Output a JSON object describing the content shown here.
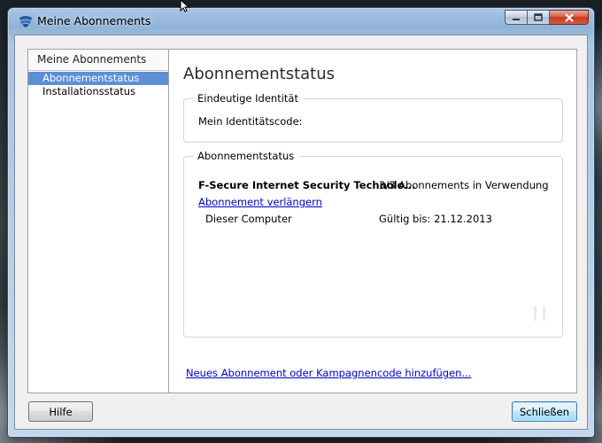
{
  "window": {
    "title": "Meine Abonnements"
  },
  "sidebar": {
    "header": "Meine Abonnements",
    "items": [
      {
        "label": "Abonnementstatus",
        "selected": true
      },
      {
        "label": "Installationsstatus",
        "selected": false
      }
    ]
  },
  "main": {
    "title": "Abonnementstatus",
    "identity": {
      "legend": "Eindeutige Identität",
      "code_label": "Mein Identitätscode:"
    },
    "status": {
      "legend": "Abonnementstatus",
      "product_name": "F-Secure Internet Security Technolo...",
      "usage": "3/3 Abonnements in Verwendung",
      "renew_link": "Abonnement verlängern",
      "computer_label": "Dieser Computer",
      "valid_until": "Gültig bis: 21.12.2013"
    },
    "add_link": "Neues Abonnement oder Kampagnencode hinzufügen..."
  },
  "buttons": {
    "help": "Hilfe",
    "close": "Schließen"
  },
  "icons": {
    "app": "f-secure-shield-icon",
    "minimize": "minimize-icon",
    "maximize": "maximize-icon",
    "close": "close-icon",
    "cursor": "mouse-pointer-icon"
  },
  "colors": {
    "selection": "#5d8fd6",
    "link": "#0000cc",
    "close_button": "#c4391f"
  }
}
